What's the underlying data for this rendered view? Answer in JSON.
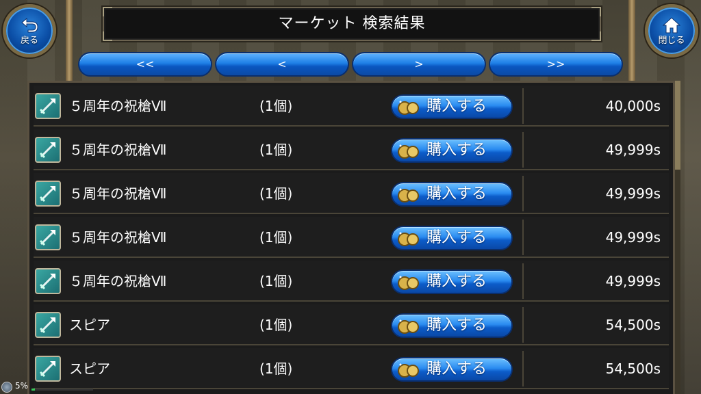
{
  "header": {
    "title": "マーケット 検索結果"
  },
  "nav": {
    "back_label": "戻る",
    "close_label": "閉じる"
  },
  "pager": {
    "first": "<<",
    "prev": "<",
    "next": ">",
    "last": ">>"
  },
  "buy_label": "購入する",
  "rows": [
    {
      "name": "５周年の祝槍Ⅶ",
      "qty": "(1個)",
      "price": "40,000s"
    },
    {
      "name": "５周年の祝槍Ⅶ",
      "qty": "(1個)",
      "price": "49,999s"
    },
    {
      "name": "５周年の祝槍Ⅶ",
      "qty": "(1個)",
      "price": "49,999s"
    },
    {
      "name": "５周年の祝槍Ⅶ",
      "qty": "(1個)",
      "price": "49,999s"
    },
    {
      "name": "５周年の祝槍Ⅶ",
      "qty": "(1個)",
      "price": "49,999s"
    },
    {
      "name": "スピア",
      "qty": "(1個)",
      "price": "54,500s"
    },
    {
      "name": "スピア",
      "qty": "(1個)",
      "price": "54,500s"
    }
  ],
  "status": {
    "percent_label": "5%",
    "percent": 5
  },
  "colors": {
    "button_blue": "#1e7fe6",
    "panel_bg": "#1b1b1b",
    "frame_gold": "#7a6a45"
  }
}
